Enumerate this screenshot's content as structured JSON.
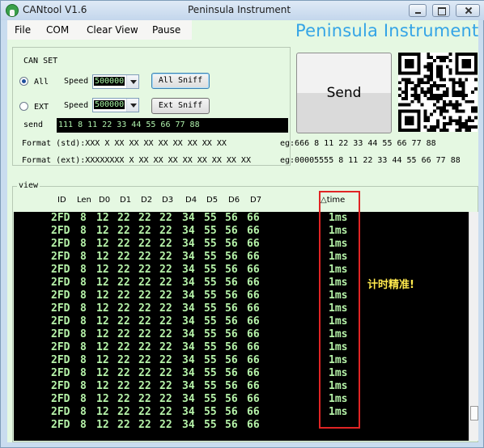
{
  "window": {
    "app_title": "CANtool V1.6",
    "center_title": "Peninsula Instrument"
  },
  "menu": [
    "File",
    "COM",
    "Clear View",
    "Pause"
  ],
  "brand": "Peninsula Instrument",
  "can_set": {
    "legend": "CAN SET",
    "all": {
      "label": "All",
      "speed_label": "Speed",
      "speed_value": "500000",
      "button": "All Sniff"
    },
    "ext": {
      "label": "EXT",
      "speed_label": "Speed",
      "speed_value": "500000",
      "button": "Ext Sniff"
    },
    "send_label": "send",
    "send_value": "111 8 11 22 33 44 55 66 77 88",
    "format_std": "Format (std):XXX X XX XX XX XX XX XX XX XX",
    "format_ext": "Format (ext):XXXXXXXX X XX XX XX XX XX XX XX XX",
    "eg_std": "eg:666 8 11 22 33 44 55 66 77 88",
    "eg_ext": "eg:00005555 8 11 22 33 44 55 66 77 88"
  },
  "send_button": "Send",
  "view": {
    "legend": "view",
    "columns": [
      "ID",
      "Len",
      "D0",
      "D1",
      "D2",
      "D3",
      "D4",
      "D5",
      "D6",
      "D7",
      "△time"
    ],
    "rows": [
      [
        "2FD",
        "8",
        "12",
        "22",
        "22",
        "22",
        "34",
        "55",
        "56",
        "66",
        "1ms"
      ],
      [
        "2FD",
        "8",
        "12",
        "22",
        "22",
        "22",
        "34",
        "55",
        "56",
        "66",
        "1ms"
      ],
      [
        "2FD",
        "8",
        "12",
        "22",
        "22",
        "22",
        "34",
        "55",
        "56",
        "66",
        "1ms"
      ],
      [
        "2FD",
        "8",
        "12",
        "22",
        "22",
        "22",
        "34",
        "55",
        "56",
        "66",
        "1ms"
      ],
      [
        "2FD",
        "8",
        "12",
        "22",
        "22",
        "22",
        "34",
        "55",
        "56",
        "66",
        "1ms"
      ],
      [
        "2FD",
        "8",
        "12",
        "22",
        "22",
        "22",
        "34",
        "55",
        "56",
        "66",
        "1ms"
      ],
      [
        "2FD",
        "8",
        "12",
        "22",
        "22",
        "22",
        "34",
        "55",
        "56",
        "66",
        "1ms"
      ],
      [
        "2FD",
        "8",
        "12",
        "22",
        "22",
        "22",
        "34",
        "55",
        "56",
        "66",
        "1ms"
      ],
      [
        "2FD",
        "8",
        "12",
        "22",
        "22",
        "22",
        "34",
        "55",
        "56",
        "66",
        "1ms"
      ],
      [
        "2FD",
        "8",
        "12",
        "22",
        "22",
        "22",
        "34",
        "55",
        "56",
        "66",
        "1ms"
      ],
      [
        "2FD",
        "8",
        "12",
        "22",
        "22",
        "22",
        "34",
        "55",
        "56",
        "66",
        "1ms"
      ],
      [
        "2FD",
        "8",
        "12",
        "22",
        "22",
        "22",
        "34",
        "55",
        "56",
        "66",
        "1ms"
      ],
      [
        "2FD",
        "8",
        "12",
        "22",
        "22",
        "22",
        "34",
        "55",
        "56",
        "66",
        "1ms"
      ],
      [
        "2FD",
        "8",
        "12",
        "22",
        "22",
        "22",
        "34",
        "55",
        "56",
        "66",
        "1ms"
      ],
      [
        "2FD",
        "8",
        "12",
        "22",
        "22",
        "22",
        "34",
        "55",
        "56",
        "66",
        "1ms"
      ],
      [
        "2FD",
        "8",
        "12",
        "22",
        "22",
        "22",
        "34",
        "55",
        "56",
        "66",
        "1ms"
      ],
      [
        "2FD",
        "8",
        "12",
        "22",
        "22",
        "22",
        "34",
        "55",
        "56",
        "66",
        ""
      ]
    ],
    "annotation": "计时精准!"
  },
  "colors": {
    "client_bg": "#e5f8e2",
    "brand": "#34a4e6",
    "log_text": "#b6f3a9",
    "highlight": "#e02424",
    "annotation": "#ffe94d"
  }
}
